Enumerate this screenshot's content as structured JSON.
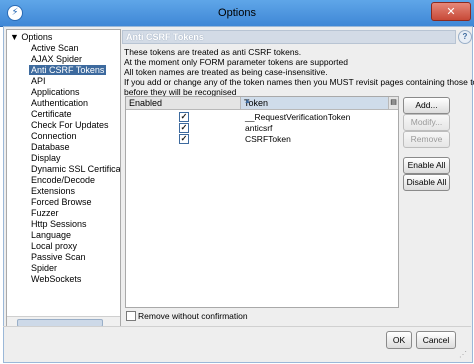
{
  "window": {
    "title": "Options",
    "close_glyph": "✕",
    "app_icon": "zap-logo-icon"
  },
  "tree": {
    "root": "▼ Options",
    "items": [
      "Active Scan",
      "AJAX Spider",
      "Anti CSRF Tokens",
      "API",
      "Applications",
      "Authentication",
      "Certificate",
      "Check For Updates",
      "Connection",
      "Database",
      "Display",
      "Dynamic SSL Certificates",
      "Encode/Decode",
      "Extensions",
      "Forced Browse",
      "Fuzzer",
      "Http Sessions",
      "Language",
      "Local proxy",
      "Passive Scan",
      "Spider",
      "WebSockets"
    ],
    "selected": "Anti CSRF Tokens"
  },
  "panel": {
    "header": "Anti CSRF Tokens",
    "description": [
      "These tokens are treated as anti CSRF tokens.",
      "At the moment only FORM parameter tokens are supported",
      "All token names are treated as being case-insensitive.",
      "If you add or change any of the token names then you MUST revisit pages containing those tokens",
      "before they will be recognised"
    ],
    "table": {
      "columns": [
        "Enabled",
        "Token"
      ],
      "rows": [
        {
          "enabled": true,
          "token": "__RequestVerificationToken"
        },
        {
          "enabled": true,
          "token": "anticsrf"
        },
        {
          "enabled": true,
          "token": "CSRFToken"
        }
      ]
    },
    "buttons": {
      "add": "Add...",
      "modify": "Modify...",
      "remove": "Remove",
      "enable_all": "Enable All",
      "disable_all": "Disable All"
    },
    "remove_without_confirmation": "Remove without confirmation"
  },
  "footer": {
    "ok": "OK",
    "cancel": "Cancel"
  },
  "icons": {
    "help": "help-icon",
    "sort": "sort-asc-icon",
    "columns": "column-selector-icon"
  }
}
